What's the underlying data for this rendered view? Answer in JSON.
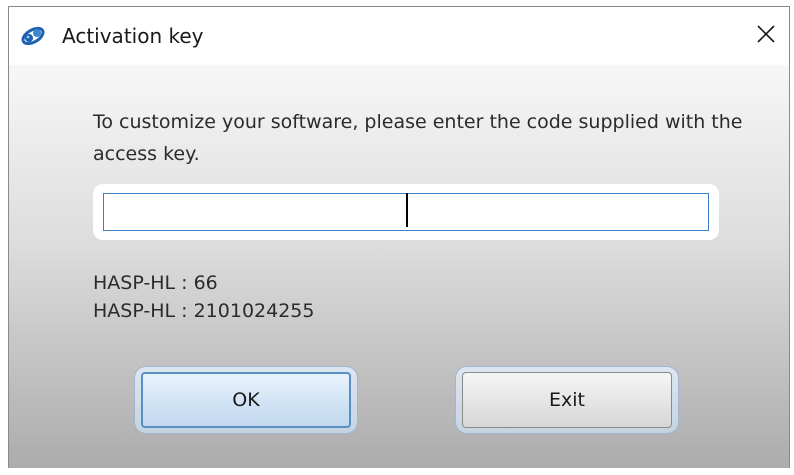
{
  "window": {
    "title": "Activation key",
    "icon": "app-logo-icon",
    "close_icon": "close-icon"
  },
  "dialog": {
    "instructions": "To customize your software, please enter the code supplied with the access key.",
    "code_input": {
      "value": "",
      "placeholder": ""
    },
    "hasp_lines": [
      "HASP-HL : 66",
      "HASP-HL : 2101024255"
    ],
    "buttons": {
      "ok_label": "OK",
      "exit_label": "Exit"
    }
  },
  "colors": {
    "input_border": "#3b7fc8",
    "ok_border": "#5a8fc4",
    "logo_blue": "#1f62b0"
  }
}
